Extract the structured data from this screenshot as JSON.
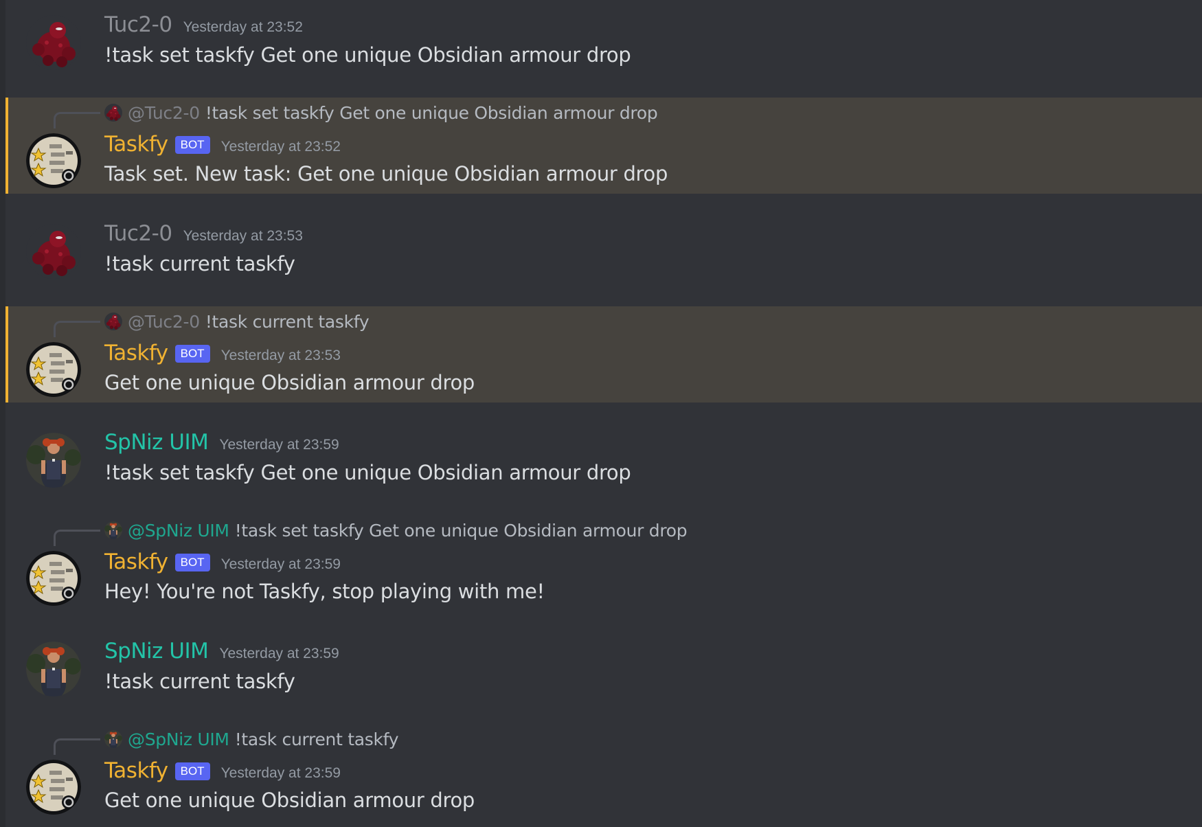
{
  "users": {
    "tuc": {
      "name": "Tuc2-0",
      "mention": "@Tuc2-0",
      "avatar_icon": "red-golem-avatar-icon",
      "color": "#8c8e94"
    },
    "taskfy": {
      "name": "Taskfy",
      "bot_badge": "BOT",
      "avatar_icon": "scroll-stars-avatar-icon",
      "color": "#f0b232"
    },
    "spniz": {
      "name": "SpNiz UIM",
      "mention": "@SpNiz UIM",
      "avatar_icon": "redhead-player-avatar-icon",
      "color": "#23c4a8"
    }
  },
  "colors": {
    "background": "#313338",
    "mention_highlight": "#46433e",
    "mention_bar": "#f0b232",
    "bot_badge": "#5865f2"
  },
  "messages": [
    {
      "author": "Tuc2-0",
      "timestamp": "Yesterday at 23:52",
      "text": "!task set taskfy Get one unique Obsidian armour drop"
    },
    {
      "author": "Taskfy",
      "badge": "BOT",
      "timestamp": "Yesterday at 23:52",
      "text": "Task set. New task: Get one unique Obsidian armour drop",
      "reply": {
        "user": "@Tuc2-0",
        "text": "!task set taskfy Get one unique Obsidian armour drop"
      },
      "highlighted": true
    },
    {
      "author": "Tuc2-0",
      "timestamp": "Yesterday at 23:53",
      "text": "!task current taskfy"
    },
    {
      "author": "Taskfy",
      "badge": "BOT",
      "timestamp": "Yesterday at 23:53",
      "text": "Get one unique Obsidian armour drop",
      "reply": {
        "user": "@Tuc2-0",
        "text": "!task current taskfy"
      },
      "highlighted": true
    },
    {
      "author": "SpNiz UIM",
      "timestamp": "Yesterday at 23:59",
      "text": "!task set taskfy Get one unique Obsidian armour drop"
    },
    {
      "author": "Taskfy",
      "badge": "BOT",
      "timestamp": "Yesterday at 23:59",
      "text": "Hey! You're not Taskfy, stop playing with me!",
      "reply": {
        "user": "@SpNiz UIM",
        "text": "!task set taskfy Get one unique Obsidian armour drop"
      },
      "highlighted": false
    },
    {
      "author": "SpNiz UIM",
      "timestamp": "Yesterday at 23:59",
      "text": "!task current taskfy"
    },
    {
      "author": "Taskfy",
      "badge": "BOT",
      "timestamp": "Yesterday at 23:59",
      "text": "Get one unique Obsidian armour drop",
      "reply": {
        "user": "@SpNiz UIM",
        "text": "!task current taskfy"
      },
      "highlighted": false
    }
  ]
}
